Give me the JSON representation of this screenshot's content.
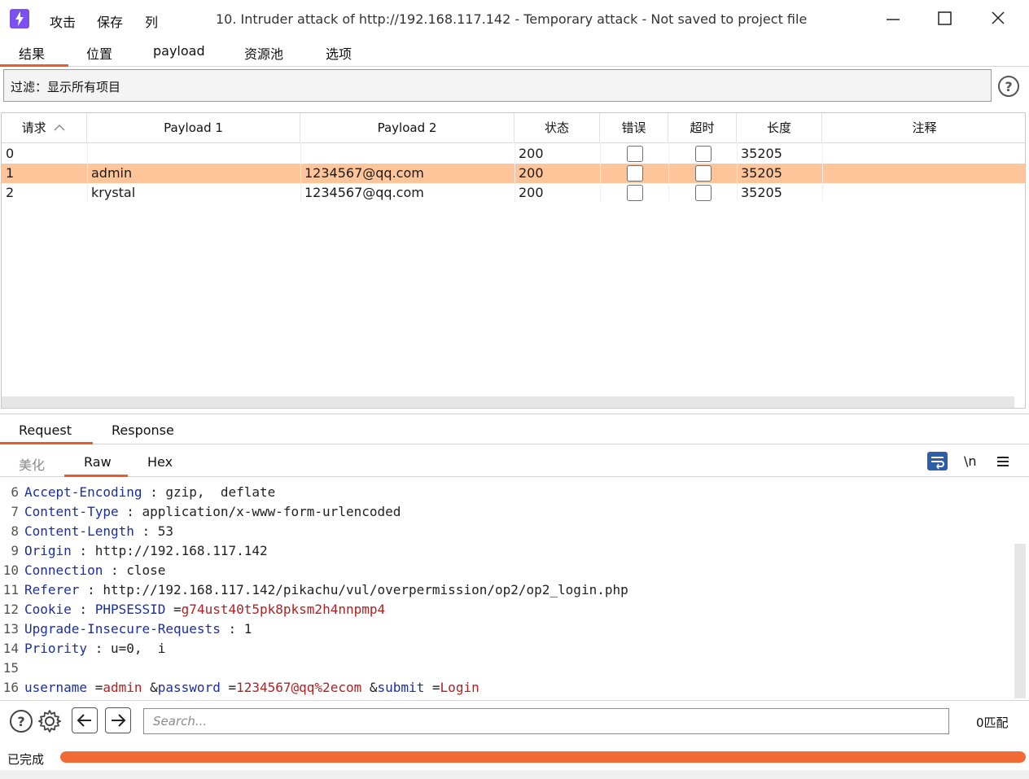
{
  "titlebar": {
    "menu": [
      "攻击",
      "保存",
      "列"
    ],
    "title": "10. Intruder attack of http://192.168.117.142 - Temporary attack - Not saved to project file"
  },
  "tabs": [
    "结果",
    "位置",
    "payload",
    "资源池",
    "选项"
  ],
  "filter": {
    "text": "过滤：显示所有项目"
  },
  "table": {
    "columns": [
      "请求",
      "Payload 1",
      "Payload 2",
      "状态",
      "错误",
      "超时",
      "长度",
      "注释"
    ],
    "sort_indicator": "^",
    "rows": [
      {
        "request": "0",
        "payload1": "",
        "payload2": "",
        "status": "200",
        "error": false,
        "timeout": false,
        "length": "35205",
        "comment": ""
      },
      {
        "request": "1",
        "payload1": "admin",
        "payload2": "1234567@qq.com",
        "status": "200",
        "error": false,
        "timeout": false,
        "length": "35205",
        "comment": "",
        "selected": true
      },
      {
        "request": "2",
        "payload1": "krystal",
        "payload2": "1234567@qq.com",
        "status": "200",
        "error": false,
        "timeout": false,
        "length": "35205",
        "comment": ""
      }
    ]
  },
  "message_tabs": [
    "Request",
    "Response"
  ],
  "view_tabs": [
    "美化",
    "Raw",
    "Hex"
  ],
  "newline_toggle": "\\n",
  "code_lines": [
    {
      "n": "6",
      "parts": [
        [
          "k",
          "Accept-Encoding"
        ],
        [
          "v",
          " : gzip,  deflate"
        ]
      ]
    },
    {
      "n": "7",
      "parts": [
        [
          "k",
          "Content-Type"
        ],
        [
          "v",
          " : application/x-www-form-urlencoded"
        ]
      ]
    },
    {
      "n": "8",
      "parts": [
        [
          "k",
          "Content-Length"
        ],
        [
          "v",
          " : 53"
        ]
      ]
    },
    {
      "n": "9",
      "parts": [
        [
          "k",
          "Origin"
        ],
        [
          "v",
          " : http://192.168.117.142"
        ]
      ]
    },
    {
      "n": "10",
      "parts": [
        [
          "k",
          "Connection"
        ],
        [
          "v",
          " : close"
        ]
      ]
    },
    {
      "n": "11",
      "parts": [
        [
          "k",
          "Referer"
        ],
        [
          "v",
          " : http://192.168.117.142/pikachu/vul/overpermission/op2/op2_login.php"
        ]
      ]
    },
    {
      "n": "12",
      "parts": [
        [
          "k",
          "Cookie"
        ],
        [
          "v",
          " : "
        ],
        [
          "k",
          "PHPSESSID"
        ],
        [
          "v",
          " ="
        ],
        [
          "r",
          "g74ust40t5pk8pksm2h4nnpmp4"
        ]
      ]
    },
    {
      "n": "13",
      "parts": [
        [
          "k",
          "Upgrade-Insecure-Requests"
        ],
        [
          "v",
          " : 1"
        ]
      ]
    },
    {
      "n": "14",
      "parts": [
        [
          "k",
          "Priority"
        ],
        [
          "v",
          " : u=0,  i"
        ]
      ]
    },
    {
      "n": "15",
      "parts": []
    },
    {
      "n": "16",
      "parts": [
        [
          "k",
          "username"
        ],
        [
          "v",
          " ="
        ],
        [
          "r",
          "admin"
        ],
        [
          "v",
          " &"
        ],
        [
          "k",
          "password"
        ],
        [
          "v",
          " ="
        ],
        [
          "r",
          "1234567@qq%2ecom"
        ],
        [
          "v",
          " &"
        ],
        [
          "k",
          "submit"
        ],
        [
          "v",
          " ="
        ],
        [
          "r",
          "Login"
        ]
      ]
    }
  ],
  "search": {
    "placeholder": "Search...",
    "matches": "0匹配"
  },
  "status": {
    "text": "已完成",
    "progress": 1.0
  },
  "colors": {
    "accent": "#f05a28",
    "selected_row": "#ffc59a",
    "progress": "#f26a36",
    "app_icon": "#7b50f0"
  }
}
